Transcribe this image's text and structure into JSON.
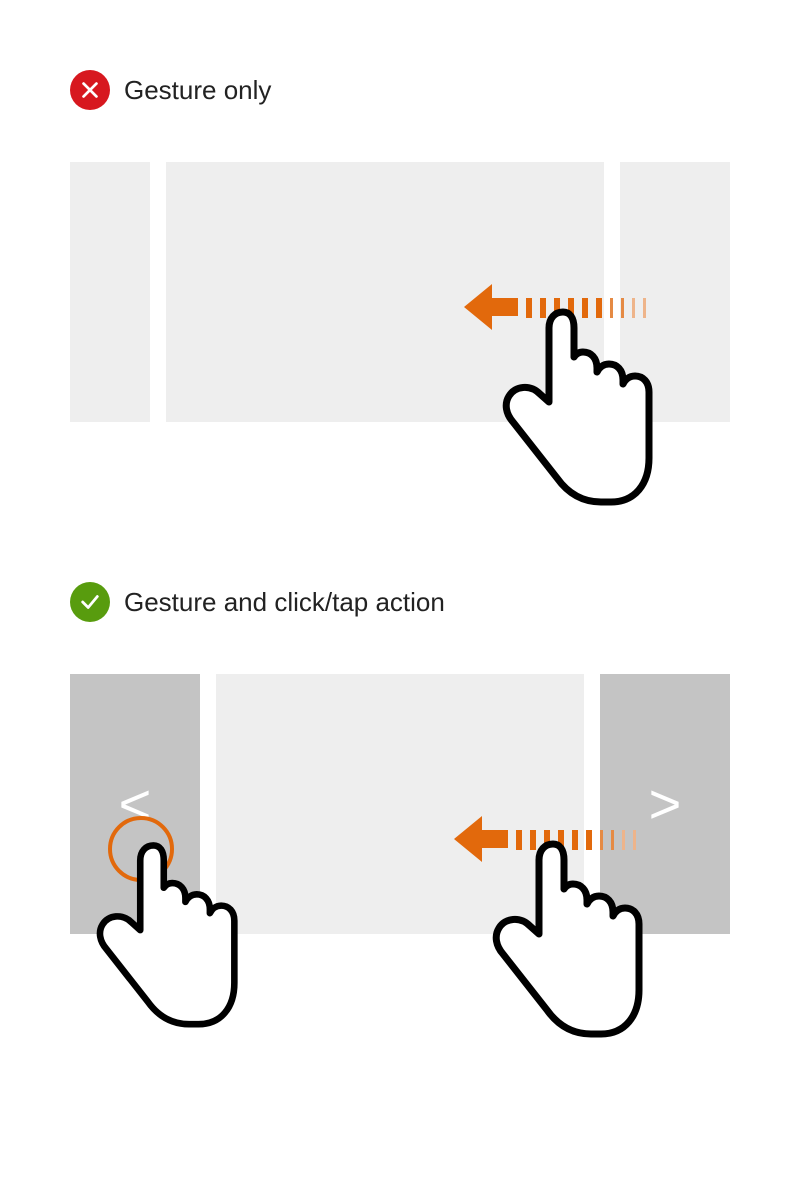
{
  "colors": {
    "bad": "#d7181f",
    "good": "#589c0e",
    "accent": "#e2690c",
    "slide_bg": "#eeeeee",
    "nav_bg": "#c4c4c4"
  },
  "examples": {
    "bad": {
      "label": "Gesture only",
      "status": "dont"
    },
    "good": {
      "label": "Gesture and click/tap action",
      "status": "do",
      "nav_prev": "<",
      "nav_next": ">"
    }
  },
  "gesture": {
    "direction": "left",
    "type": "swipe"
  }
}
